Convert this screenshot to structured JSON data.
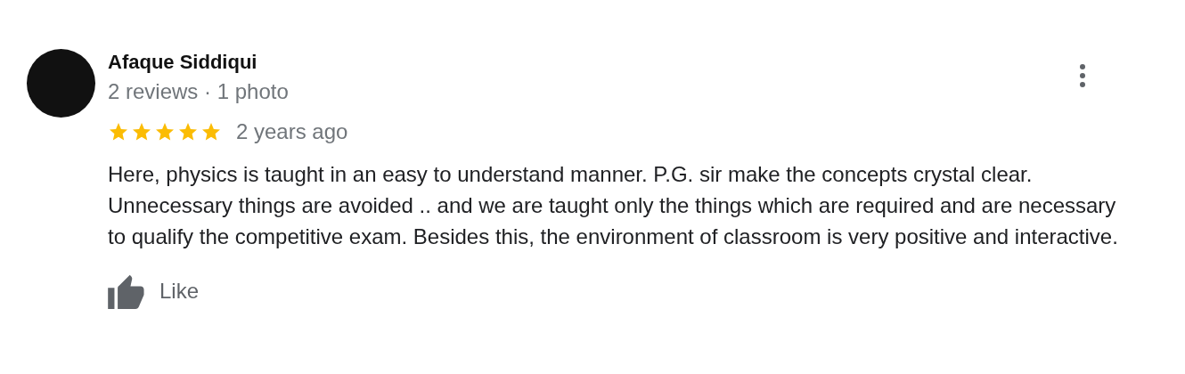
{
  "review": {
    "author": "Afaque Siddiqui",
    "meta": "2 reviews · 1 photo",
    "stars": 5,
    "time": "2 years ago",
    "text": "Here, physics is taught in an easy to understand manner. P.G. sir make the concepts crystal clear. Unnecessary things are avoided .. and we are taught only the things which are required and are necessary to qualify the competitive exam. Besides this, the environment of classroom is very positive and interactive.",
    "like_label": "Like"
  }
}
